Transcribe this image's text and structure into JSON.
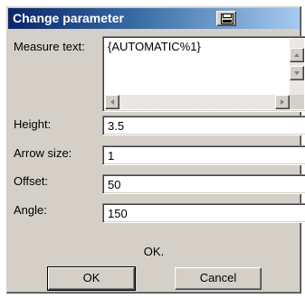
{
  "window": {
    "title": "Change parameter"
  },
  "icons": {
    "title_button": "disk-icon",
    "scroll_up": "arrow-up-icon",
    "scroll_down": "arrow-down-icon",
    "scroll_left": "arrow-left-icon",
    "scroll_right": "arrow-right-icon"
  },
  "colors": {
    "title_bar_start": "#0a246a",
    "title_bar_end": "#a6caf0",
    "dialog_face": "#d4d0c8"
  },
  "form": {
    "measure_text": {
      "label": "Measure text:",
      "value": "{AUTOMATIC%1}"
    },
    "height": {
      "label": "Height:",
      "value": "3.5"
    },
    "arrow_size": {
      "label": "Arrow size:",
      "value": "1"
    },
    "offset": {
      "label": "Offset:",
      "value": "50"
    },
    "angle": {
      "label": "Angle:",
      "value": "150"
    }
  },
  "status": {
    "text": "OK."
  },
  "buttons": {
    "ok": "OK",
    "cancel": "Cancel"
  }
}
